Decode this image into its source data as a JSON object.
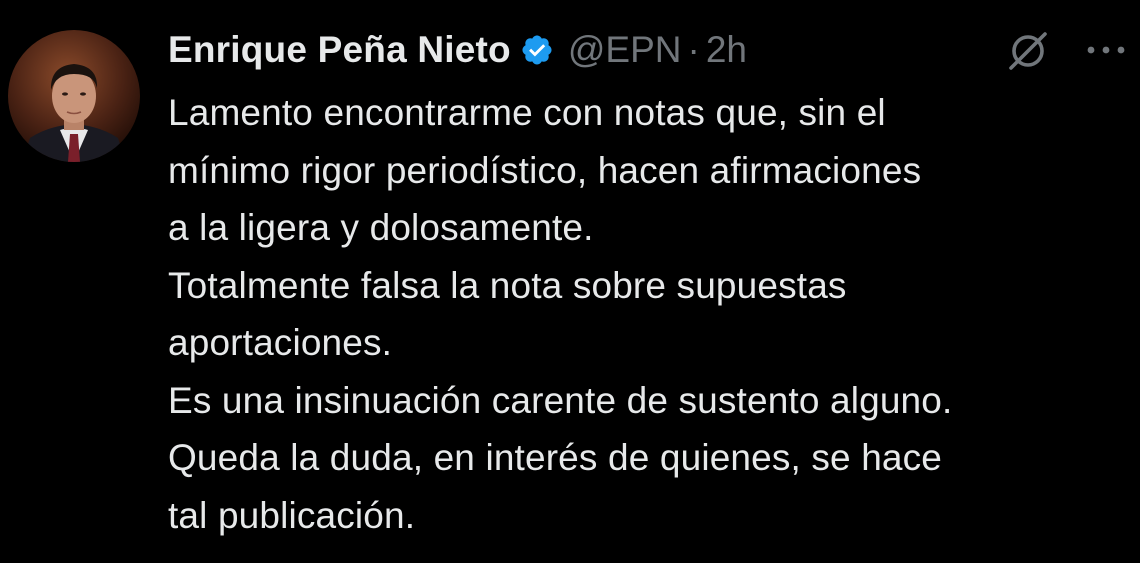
{
  "tweet": {
    "author": {
      "display_name": "Enrique Peña Nieto",
      "handle": "@EPN",
      "verified": true,
      "verified_icon": "verified-badge-icon",
      "avatar_icon": "avatar"
    },
    "separator": "·",
    "time": "2h",
    "actions": {
      "grok_icon": "grok-icon",
      "more_icon": "more-icon"
    },
    "lines": [
      "Lamento encontrarme con notas que, sin el",
      "mínimo rigor periodístico, hacen afirmaciones",
      "a la ligera y dolosamente.",
      "Totalmente falsa la nota sobre supuestas",
      "aportaciones.",
      "Es una insinuación carente de sustento alguno.",
      "Queda la duda, en interés de quienes,  se hace",
      "tal publicación."
    ]
  },
  "colors": {
    "background": "#000000",
    "primary_text": "#e7e9ea",
    "secondary_text": "#71767b",
    "verified_blue": "#1d9bf0"
  }
}
